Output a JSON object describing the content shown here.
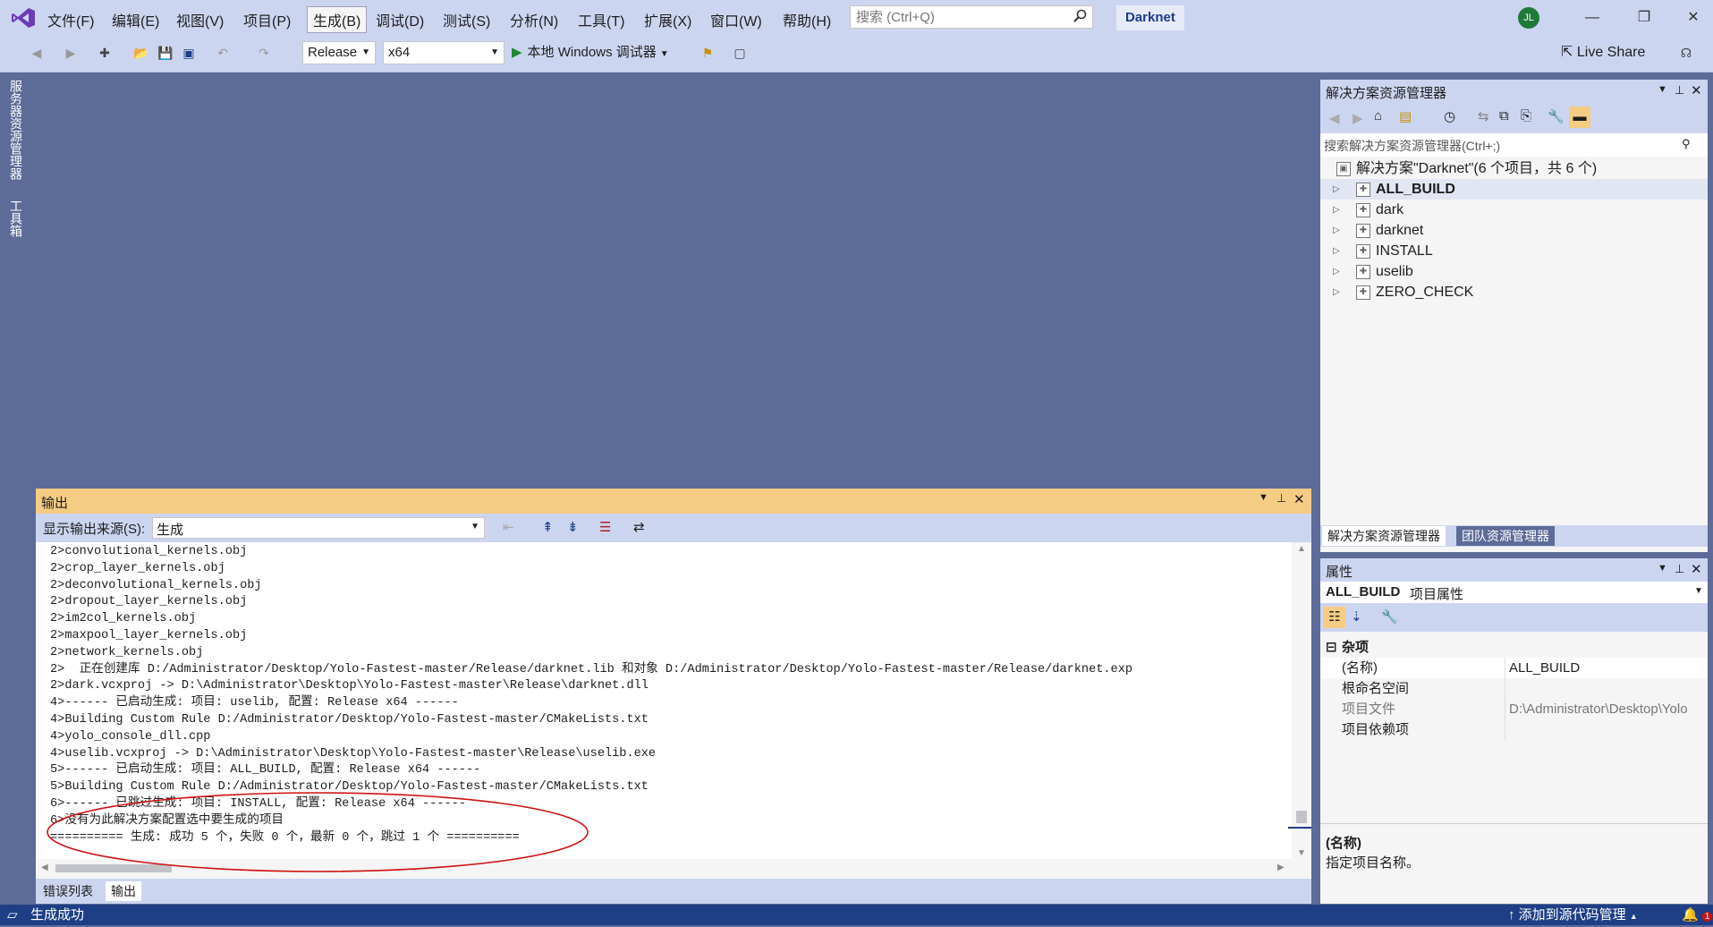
{
  "title_bar": {
    "menus": [
      "文件(F)",
      "编辑(E)",
      "视图(V)",
      "项目(P)",
      "生成(B)",
      "调试(D)",
      "测试(S)",
      "分析(N)",
      "工具(T)",
      "扩展(X)",
      "窗口(W)",
      "帮助(H)"
    ],
    "active_menu": "生成(B)",
    "search_placeholder": "搜索 (Ctrl+Q)",
    "solution_name": "Darknet",
    "user_initials": "JL"
  },
  "toolbar": {
    "configuration": "Release",
    "platform": "x64",
    "run_label": "本地 Windows 调试器",
    "live_share": "Live Share"
  },
  "left_tabs": {
    "server_explorer": "服务器资源管理器",
    "toolbox": "工具箱"
  },
  "output": {
    "title": "输出",
    "source_label": "显示输出来源(S):",
    "source_value": "生成",
    "lines": [
      "2>convolutional_kernels.obj",
      "2>crop_layer_kernels.obj",
      "2>deconvolutional_kernels.obj",
      "2>dropout_layer_kernels.obj",
      "2>im2col_kernels.obj",
      "2>maxpool_layer_kernels.obj",
      "2>network_kernels.obj",
      "2>  正在创建库 D:/Administrator/Desktop/Yolo-Fastest-master/Release/darknet.lib 和对象 D:/Administrator/Desktop/Yolo-Fastest-master/Release/darknet.exp",
      "2>dark.vcxproj -> D:\\Administrator\\Desktop\\Yolo-Fastest-master\\Release\\darknet.dll",
      "4>------ 已启动生成: 项目: uselib, 配置: Release x64 ------",
      "4>Building Custom Rule D:/Administrator/Desktop/Yolo-Fastest-master/CMakeLists.txt",
      "4>yolo_console_dll.cpp",
      "4>uselib.vcxproj -> D:\\Administrator\\Desktop\\Yolo-Fastest-master\\Release\\uselib.exe",
      "5>------ 已启动生成: 项目: ALL_BUILD, 配置: Release x64 ------",
      "5>Building Custom Rule D:/Administrator/Desktop/Yolo-Fastest-master/CMakeLists.txt",
      "6>------ 已跳过生成: 项目: INSTALL, 配置: Release x64 ------",
      "6>没有为此解决方案配置选中要生成的项目",
      "========== 生成: 成功 5 个，失败 0 个，最新 0 个，跳过 1 个 =========="
    ],
    "tabs": [
      "错误列表",
      "输出"
    ],
    "active_tab": "输出"
  },
  "solution_explorer": {
    "title": "解决方案资源管理器",
    "search_placeholder": "搜索解决方案资源管理器(Ctrl+;)",
    "root": "解决方案\"Darknet\"(6 个项目，共 6 个)",
    "projects": [
      "ALL_BUILD",
      "dark",
      "darknet",
      "INSTALL",
      "uselib",
      "ZERO_CHECK"
    ],
    "tabs": [
      "解决方案资源管理器",
      "团队资源管理器"
    ]
  },
  "properties": {
    "title": "属性",
    "object_name": "ALL_BUILD",
    "object_type": "项目属性",
    "category": "杂项",
    "rows": [
      {
        "key": "(名称)",
        "value": "ALL_BUILD"
      },
      {
        "key": "根命名空间",
        "value": ""
      },
      {
        "key": "项目文件",
        "value": "D:\\Administrator\\Desktop\\Yolo"
      },
      {
        "key": "项目依赖项",
        "value": ""
      }
    ],
    "desc_title": "(名称)",
    "desc_text": "指定项目名称。"
  },
  "status_bar": {
    "message": "生成成功",
    "source_control": "添加到源代码管理",
    "notifications": "1"
  },
  "colors": {
    "chrome": "#ccd5f0",
    "active_tool_title": "#f5cc84",
    "status_bar": "#1e3f86",
    "annotation_ellipse": "#d01010"
  }
}
